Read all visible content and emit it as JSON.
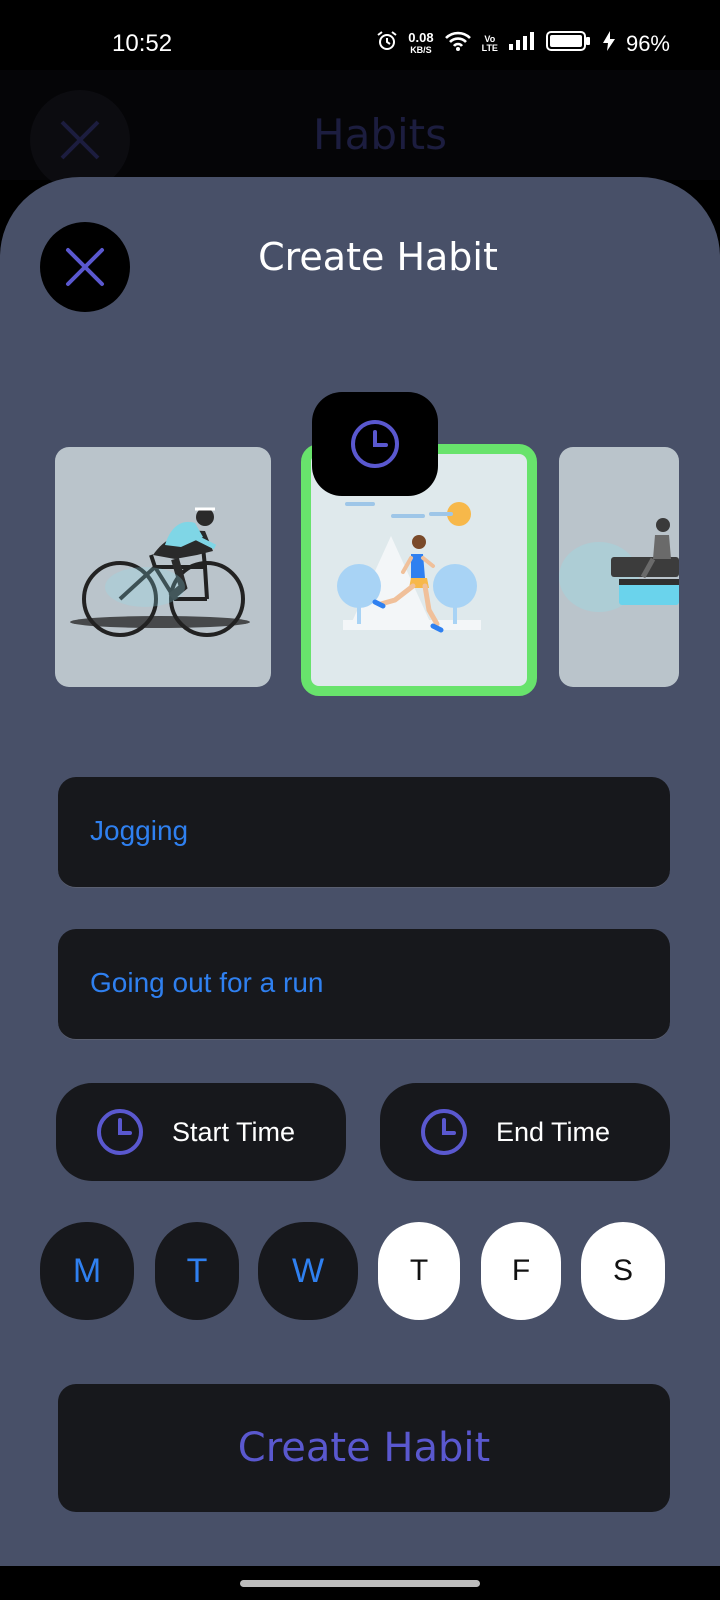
{
  "status_bar": {
    "time": "10:52",
    "speed_value": "0.08",
    "speed_unit": "KB/S",
    "volte_top": "Vo",
    "volte_bottom": "LTE",
    "battery": "96%"
  },
  "background": {
    "title": "Habits"
  },
  "sheet": {
    "title": "Create Habit",
    "images": [
      {
        "name": "cycling"
      },
      {
        "name": "jogging",
        "selected": true
      },
      {
        "name": "bench-sitting"
      }
    ],
    "name_value": "Jogging",
    "description_value": "Going out for a run",
    "start_time_label": "Start Time",
    "end_time_label": "End Time",
    "days": [
      {
        "label": "M",
        "selected": true
      },
      {
        "label": "T",
        "selected": true
      },
      {
        "label": "W",
        "selected": true
      },
      {
        "label": "T",
        "selected": false
      },
      {
        "label": "F",
        "selected": false
      },
      {
        "label": "S",
        "selected": false
      }
    ],
    "create_button": "Create Habit"
  },
  "colors": {
    "sheet_bg": "#485068",
    "field_bg": "#17181c",
    "accent_blue": "#2f80f0",
    "accent_purple": "#5a58cf",
    "selected_border": "#68e36c"
  }
}
